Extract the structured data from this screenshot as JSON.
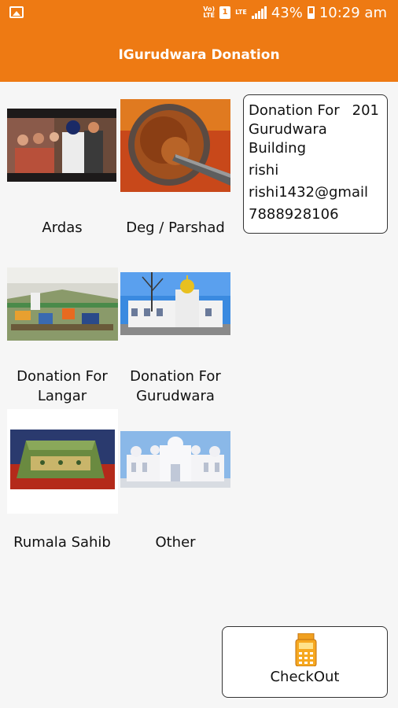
{
  "status_bar": {
    "network_top": "Vo)",
    "network_bottom": "LTE",
    "notif_box": "1",
    "lte2": "LTE",
    "battery": "43%",
    "time": "10:29 am"
  },
  "app_bar": {
    "title": "IGurudwara Donation"
  },
  "grid": {
    "items": [
      {
        "label": "Ardas"
      },
      {
        "label": "Deg / Parshad"
      },
      {
        "label": "Donation For Langar"
      },
      {
        "label": "Donation For Gurudwara"
      },
      {
        "label": "Rumala Sahib"
      },
      {
        "label": "Other"
      }
    ]
  },
  "cart": {
    "item_line1": "Donation For",
    "item_line2": "Gurudwara",
    "item_line3": "Building",
    "amount": "201",
    "name": "rishi",
    "email": "rishi1432@gmail",
    "phone": "7888928106"
  },
  "checkout": {
    "label": "CheckOut"
  },
  "colors": {
    "accent": "#ee7a13",
    "background": "#f6f6f6"
  }
}
